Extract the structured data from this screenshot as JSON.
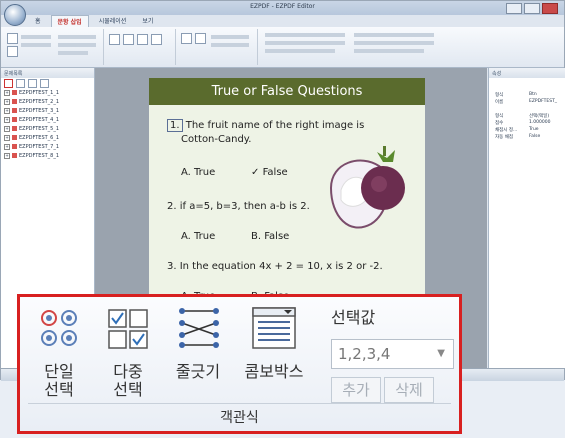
{
  "window": {
    "title": "EZPDF - EZPDF Editor"
  },
  "tabs": [
    "홈",
    "문항 삽입",
    "시뮬레이션",
    "보기"
  ],
  "left_panel": {
    "title": "문제목록",
    "items": [
      "EZPDFTEST_1_1",
      "EZPDFTEST_2_1",
      "EZPDFTEST_3_1",
      "EZPDFTEST_4_1",
      "EZPDFTEST_5_1",
      "EZPDFTEST_6_1",
      "EZPDFTEST_7_1",
      "EZPDFTEST_8_1"
    ]
  },
  "document": {
    "title": "True or False Questions",
    "q1_num": "1.",
    "q1_text_line1": "The fruit name of the right image is",
    "q1_text_line2": "Cotton-Candy.",
    "q1_a": "A. True",
    "q1_b": "False",
    "q2_text": "2.  if a=5, b=3, then a-b is 2.",
    "q2_a": "A.  True",
    "q2_b": "B.  False",
    "q3_text": "3.  In the equation 4x + 2 = 10, x is 2 or -2.",
    "q3_a": "A.  True",
    "q3_b": "B.  False"
  },
  "right_panel": {
    "title": "속성",
    "rows": [
      {
        "k": "형식",
        "v": "Btn"
      },
      {
        "k": "이름",
        "v": "EZPDFTEST_"
      },
      {
        "k": "형식",
        "v": "선택(택일)"
      },
      {
        "k": "점수",
        "v": "1.000000"
      },
      {
        "k": "채점시 정...",
        "v": "True"
      },
      {
        "k": "자동 채점",
        "v": "False"
      }
    ]
  },
  "callout": {
    "single_choice": "단일\n선택",
    "multi_choice": "다중\n선택",
    "line_connect": "줄긋기",
    "combobox": "콤보박스",
    "select_value_label": "선택값",
    "select_value": "1,2,3,4",
    "add": "추가",
    "delete": "삭제",
    "group_title": "객관식"
  },
  "colors": {
    "callout_border": "#d82020",
    "page_header": "#5a6b2d"
  }
}
